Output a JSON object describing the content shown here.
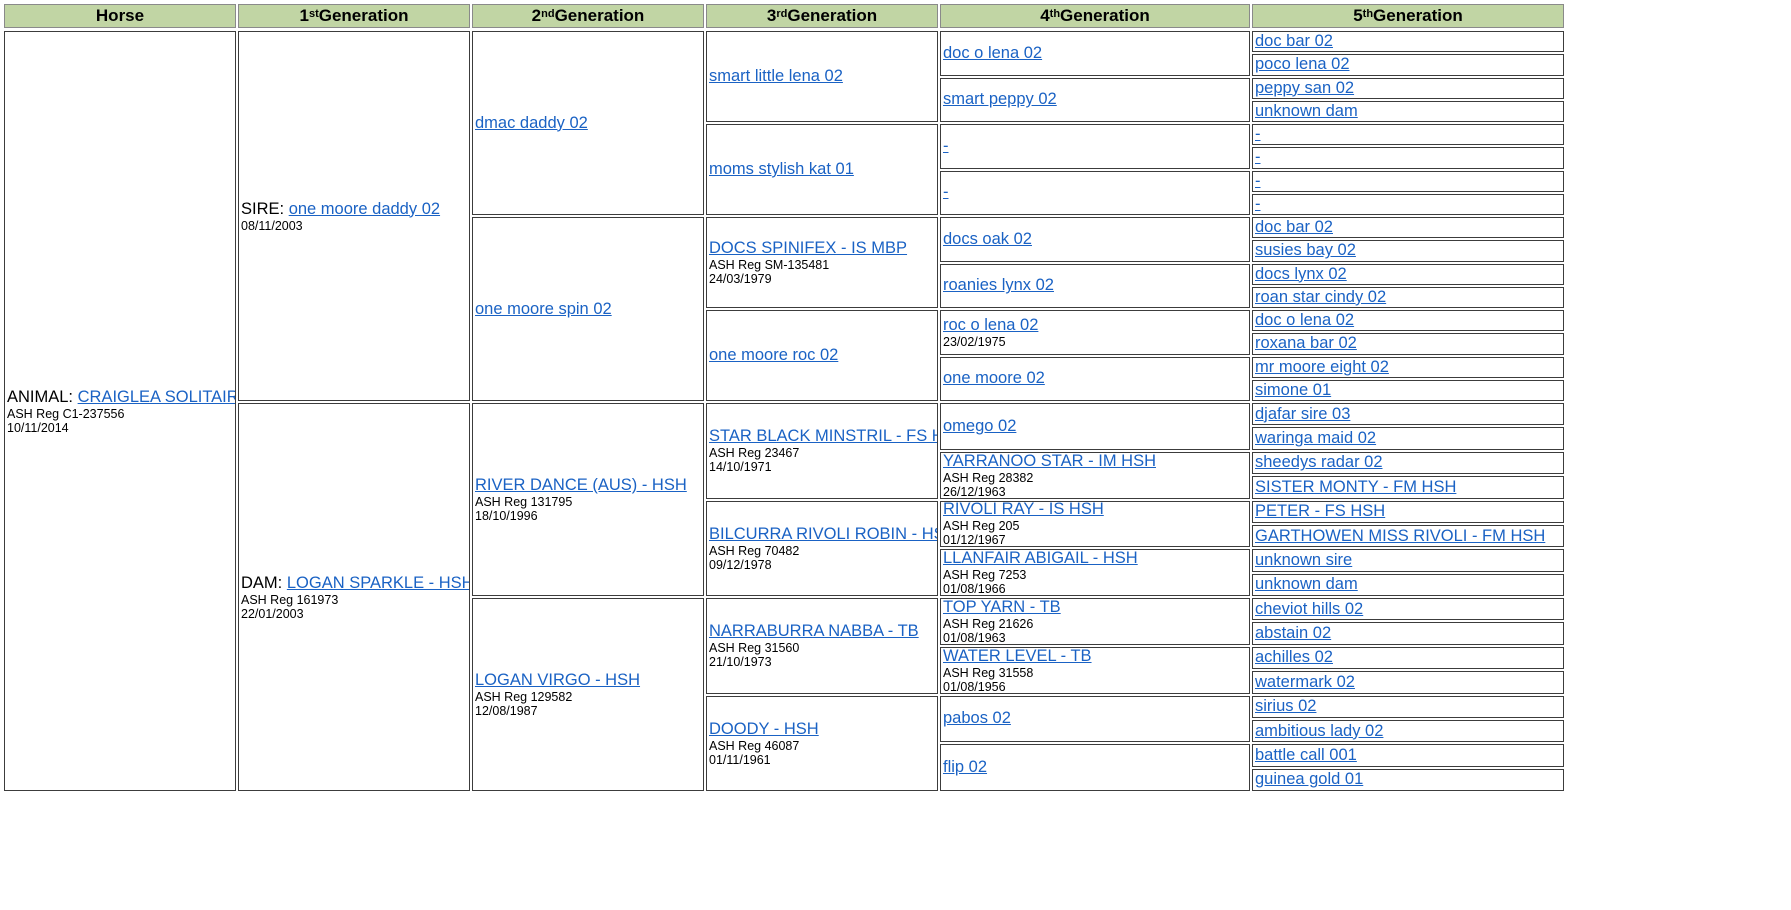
{
  "link_color": "#1a62c4",
  "header_color": "#c1d5a4",
  "headers": [
    {
      "label": "Horse",
      "sup": ""
    },
    {
      "label": "1",
      "sup": "st",
      "rest": " Generation"
    },
    {
      "label": "2",
      "sup": "nd",
      "rest": " Generation"
    },
    {
      "label": "3",
      "sup": "rd",
      "rest": " Generation"
    },
    {
      "label": "4",
      "sup": "th",
      "rest": " Generation"
    },
    {
      "label": "5",
      "sup": "th",
      "rest": " Generation"
    }
  ],
  "horse": {
    "prefix": "ANIMAL: ",
    "name": "CRAIGLEA SOLITAIRE",
    "reg": "ASH Reg C1-237556",
    "date": "10/11/2014"
  },
  "gen1": [
    {
      "prefix": "SIRE: ",
      "name": "one moore daddy 02",
      "reg": "",
      "date": "08/11/2003"
    },
    {
      "prefix": "DAM: ",
      "name": "LOGAN SPARKLE - HSH",
      "reg": "ASH Reg 161973",
      "date": "22/01/2003"
    }
  ],
  "gen2": [
    {
      "name": "dmac daddy 02",
      "reg": "",
      "date": ""
    },
    {
      "name": "one moore spin 02",
      "reg": "",
      "date": ""
    },
    {
      "name": "RIVER DANCE (AUS) - HSH",
      "reg": "ASH Reg 131795",
      "date": "18/10/1996"
    },
    {
      "name": "LOGAN VIRGO - HSH",
      "reg": "ASH Reg 129582",
      "date": "12/08/1987"
    }
  ],
  "gen3": [
    {
      "name": "smart little lena 02",
      "reg": "",
      "date": ""
    },
    {
      "name": "moms stylish kat 01",
      "reg": "",
      "date": ""
    },
    {
      "name": "DOCS SPINIFEX - IS MBP",
      "reg": "ASH Reg SM-135481",
      "date": "24/03/1979"
    },
    {
      "name": "one moore roc 02",
      "reg": "",
      "date": ""
    },
    {
      "name": "STAR BLACK MINSTRIL - FS HSH",
      "reg": "ASH Reg 23467",
      "date": "14/10/1971"
    },
    {
      "name": "BILCURRA RIVOLI ROBIN - HSH",
      "reg": "ASH Reg 70482",
      "date": "09/12/1978"
    },
    {
      "name": "NARRABURRA NABBA - TB",
      "reg": "ASH Reg 31560",
      "date": "21/10/1973"
    },
    {
      "name": "DOODY - HSH",
      "reg": "ASH Reg 46087",
      "date": "01/11/1961"
    }
  ],
  "gen4": [
    {
      "name": "doc o lena 02",
      "reg": "",
      "date": ""
    },
    {
      "name": "smart peppy 02",
      "reg": "",
      "date": ""
    },
    {
      "name": "-",
      "reg": "",
      "date": ""
    },
    {
      "name": "-",
      "reg": "",
      "date": ""
    },
    {
      "name": "docs oak 02",
      "reg": "",
      "date": ""
    },
    {
      "name": "roanies lynx 02",
      "reg": "",
      "date": ""
    },
    {
      "name": "roc o lena 02",
      "reg": "",
      "date": "23/02/1975"
    },
    {
      "name": "one moore 02",
      "reg": "",
      "date": ""
    },
    {
      "name": "omego 02",
      "reg": "",
      "date": ""
    },
    {
      "name": "YARRANOO STAR - IM HSH",
      "reg": "ASH Reg 28382",
      "date": "26/12/1963"
    },
    {
      "name": "RIVOLI RAY - IS HSH",
      "reg": "ASH Reg 205",
      "date": "01/12/1967"
    },
    {
      "name": "LLANFAIR ABIGAIL - HSH",
      "reg": "ASH Reg 7253",
      "date": "01/08/1966"
    },
    {
      "name": "TOP YARN - TB",
      "reg": "ASH Reg 21626",
      "date": "01/08/1963"
    },
    {
      "name": "WATER LEVEL - TB",
      "reg": "ASH Reg 31558",
      "date": "01/08/1956"
    },
    {
      "name": "pabos 02",
      "reg": "",
      "date": ""
    },
    {
      "name": "flip 02",
      "reg": "",
      "date": ""
    }
  ],
  "gen5": [
    {
      "name": "doc bar 02"
    },
    {
      "name": "poco lena 02"
    },
    {
      "name": "peppy san 02"
    },
    {
      "name": "unknown dam"
    },
    {
      "name": "-"
    },
    {
      "name": "-"
    },
    {
      "name": "-"
    },
    {
      "name": "-"
    },
    {
      "name": "doc bar 02"
    },
    {
      "name": "susies bay 02"
    },
    {
      "name": "docs lynx 02"
    },
    {
      "name": "roan star cindy 02"
    },
    {
      "name": "doc o lena 02"
    },
    {
      "name": "roxana bar 02"
    },
    {
      "name": "mr moore eight 02"
    },
    {
      "name": "simone 01"
    },
    {
      "name": "djafar sire 03"
    },
    {
      "name": "waringa maid 02"
    },
    {
      "name": "sheedys radar 02"
    },
    {
      "name": "SISTER MONTY - FM HSH"
    },
    {
      "name": "PETER - FS HSH"
    },
    {
      "name": "GARTHOWEN MISS RIVOLI - FM HSH"
    },
    {
      "name": "unknown sire"
    },
    {
      "name": "unknown dam"
    },
    {
      "name": "cheviot hills 02"
    },
    {
      "name": "abstain 02"
    },
    {
      "name": "achilles 02"
    },
    {
      "name": "watermark 02"
    },
    {
      "name": "sirius 02"
    },
    {
      "name": "ambitious lady 02"
    },
    {
      "name": "battle call 001"
    },
    {
      "name": "guinea gold 01"
    }
  ]
}
